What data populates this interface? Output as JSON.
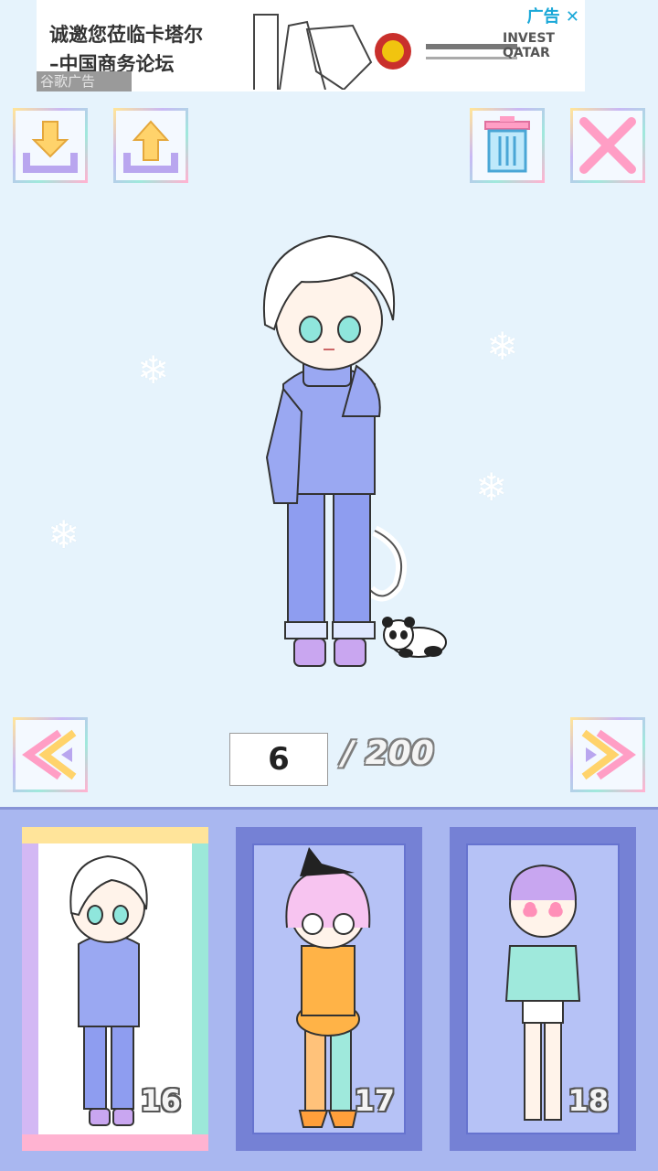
{
  "ad": {
    "headline": "诚邀您莅临卡塔尔",
    "subline": "–中国商务论坛",
    "label": "谷歌广告",
    "choice": "广告 ✕",
    "brand": "INVEST QATAR"
  },
  "toolbar": {
    "download_icon": "download-icon",
    "upload_icon": "upload-icon",
    "trash_icon": "trash-icon",
    "close_icon": "close-icon"
  },
  "navigation": {
    "current_page": "6",
    "total_pages": "/ 200",
    "prev_icon": "double-chevron-left-icon",
    "next_icon": "double-chevron-right-icon"
  },
  "cards": [
    {
      "number": "16",
      "selected": true
    },
    {
      "number": "17",
      "selected": false
    },
    {
      "number": "18",
      "selected": false
    }
  ],
  "colors": {
    "background": "#e6f3fc",
    "panel": "#a9b7f0",
    "accent_purple": "#b9a6ef",
    "accent_yellow": "#ffd36b"
  }
}
